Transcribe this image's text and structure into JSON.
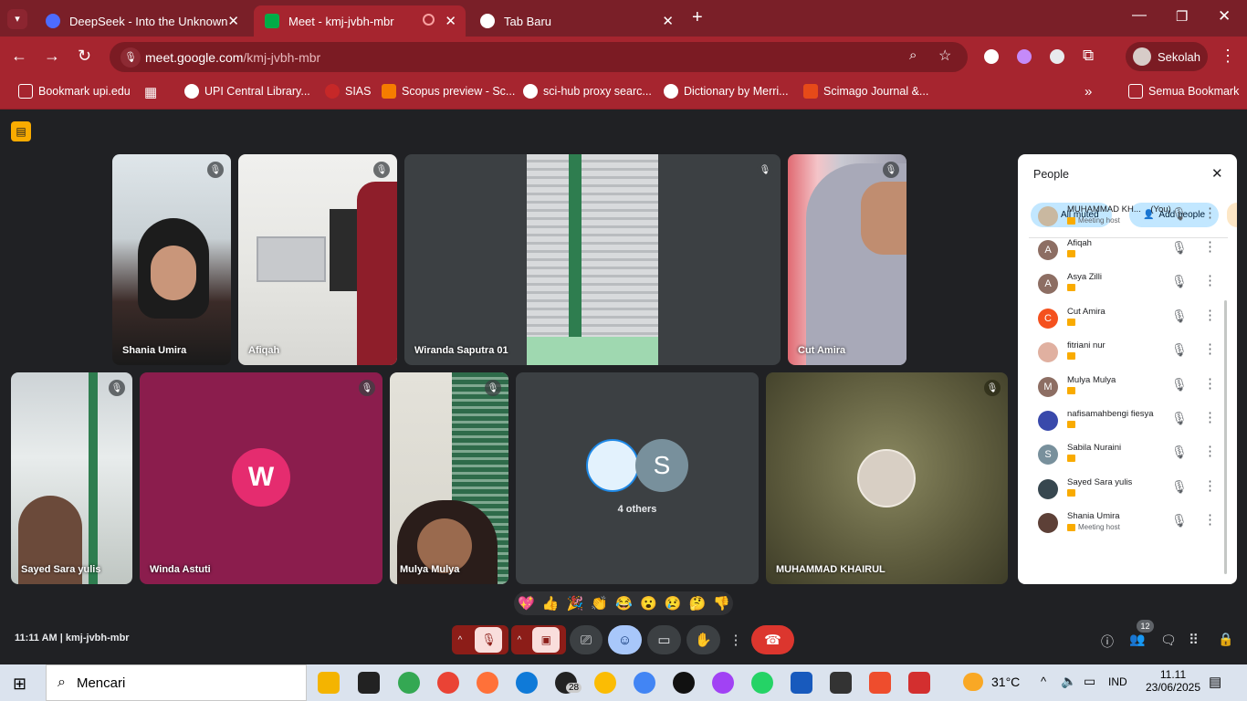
{
  "browser": {
    "tabs": [
      {
        "label": "DeepSeek - Into the Unknown",
        "active": false
      },
      {
        "label": "Meet - kmj-jvbh-mbr",
        "active": true
      },
      {
        "label": "Tab Baru",
        "active": false
      }
    ],
    "url_domain": "meet.google.com",
    "url_path": "/kmj-jvbh-mbr",
    "profile": "Sekolah",
    "bookmarks": [
      "Bookmark upi.edu",
      "UPI Central Library...",
      "SIAS",
      "Scopus preview - Sc...",
      "sci-hub proxy searc...",
      "Dictionary by Merri...",
      "Scimago Journal &..."
    ],
    "all_bookmarks": "Semua Bookmark"
  },
  "meet": {
    "tiles": [
      {
        "name": "Shania Umira"
      },
      {
        "name": "Afiqah"
      },
      {
        "name": "Wiranda Saputra 01"
      },
      {
        "name": "Cut Amira"
      },
      {
        "name": "Sayed Sara yulis"
      },
      {
        "name": "Winda Astuti",
        "initial": "W"
      },
      {
        "name": "Mulya Mulya"
      },
      {
        "name": "4 others",
        "initial": "S"
      },
      {
        "name": "MUHAMMAD KHAIRUL"
      }
    ],
    "emojis": [
      "💖",
      "👍",
      "🎉",
      "👏",
      "😂",
      "😮",
      "😢",
      "🤔",
      "👎"
    ],
    "time": "11:11 AM",
    "separator": "|",
    "meeting_code": "kmj-jvbh-mbr",
    "people_count": "12"
  },
  "people_panel": {
    "title": "People",
    "all_muted": "All muted",
    "add_people": "Add people",
    "people": [
      {
        "name": "MUHAMMAD KH...",
        "you": "(You)",
        "sub": "Meeting host",
        "initial": "",
        "color": "#c9b8a0"
      },
      {
        "name": "Afiqah",
        "sub": "",
        "initial": "A",
        "color": "#8d6e63"
      },
      {
        "name": "Asya Zilli",
        "sub": "",
        "initial": "A",
        "color": "#8d6e63"
      },
      {
        "name": "Cut Amira",
        "sub": "",
        "initial": "C",
        "color": "#f4511e"
      },
      {
        "name": "fitriani nur",
        "sub": "",
        "initial": "",
        "color": "#e0b0a0"
      },
      {
        "name": "Mulya Mulya",
        "sub": "",
        "initial": "M",
        "color": "#8d6e63"
      },
      {
        "name": "nafisamahbengi fiesya",
        "sub": "",
        "initial": "",
        "color": "#3949ab"
      },
      {
        "name": "Sabila Nuraini",
        "sub": "",
        "initial": "S",
        "color": "#78909c"
      },
      {
        "name": "Sayed Sara yulis",
        "sub": "",
        "initial": "",
        "color": "#37474f"
      },
      {
        "name": "Shania Umira",
        "sub": "Meeting host",
        "initial": "",
        "color": "#5d4037"
      }
    ]
  },
  "taskbar": {
    "search": "Mencari",
    "whatsapp_badge": "28",
    "weather": "31°C",
    "lang": "IND",
    "time": "11.11",
    "date": "23/06/2025"
  }
}
